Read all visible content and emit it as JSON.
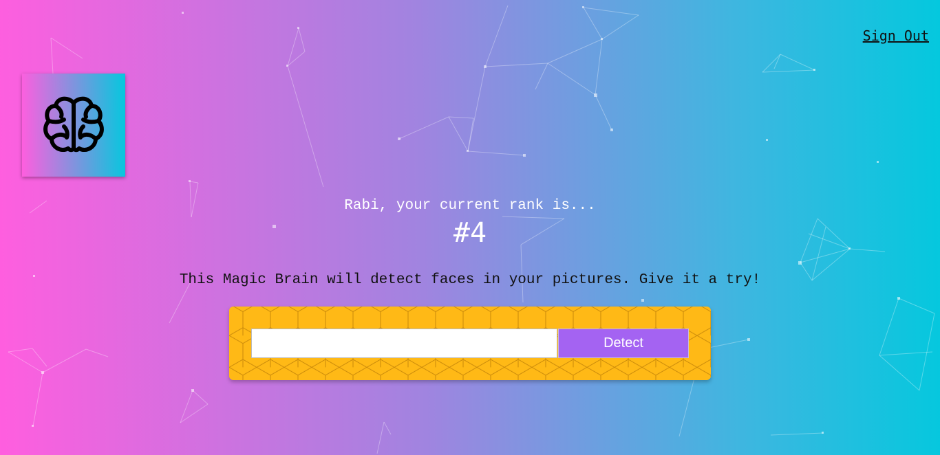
{
  "nav": {
    "sign_out_label": "Sign Out"
  },
  "logo": {
    "icon": "brain-icon"
  },
  "rank": {
    "message": "Rabi, your current rank is...",
    "value": "#4"
  },
  "intro": {
    "text": "This Magic Brain will detect faces in your pictures. Give it a try!"
  },
  "form": {
    "input_value": "",
    "detect_label": "Detect"
  },
  "colors": {
    "gradient_start": "#ff5edf",
    "gradient_end": "#04c8de",
    "form_background": "#ffb916",
    "detect_button": "#a463f2"
  }
}
